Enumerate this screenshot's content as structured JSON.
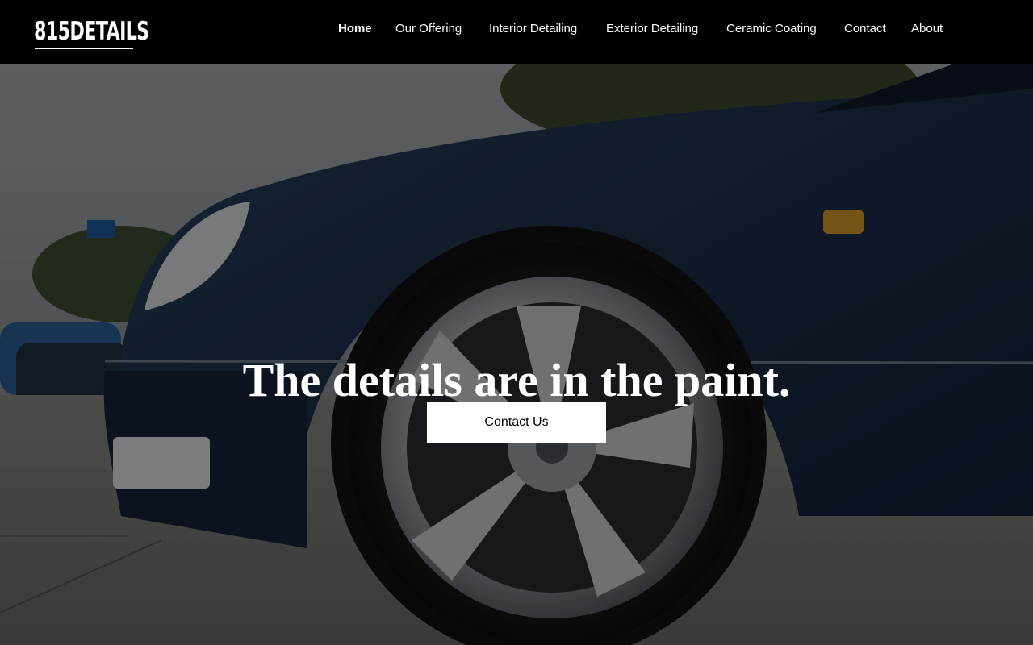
{
  "brand": {
    "logo_text": "815DETAILS"
  },
  "nav": {
    "items": [
      {
        "label": "Home",
        "active": true
      },
      {
        "label": "Our Offering"
      },
      {
        "label": "Interior Detailing"
      },
      {
        "label": "Exterior Detailing"
      },
      {
        "label": "Ceramic Coating"
      },
      {
        "label": "Contact"
      },
      {
        "label": "About"
      }
    ]
  },
  "hero": {
    "title": "The details are in the paint.",
    "cta_label": "Contact Us",
    "image_subject": "dark blue sedan front wheel with chrome rim",
    "colors": {
      "car_body": "#1e2d44",
      "overlay": "rgba(0,0,0,0.45)",
      "ground": "#7a7a78",
      "sky": "#9ea3a8",
      "chrome": "#c9ccd0",
      "indicator": "#d89a2a"
    }
  }
}
